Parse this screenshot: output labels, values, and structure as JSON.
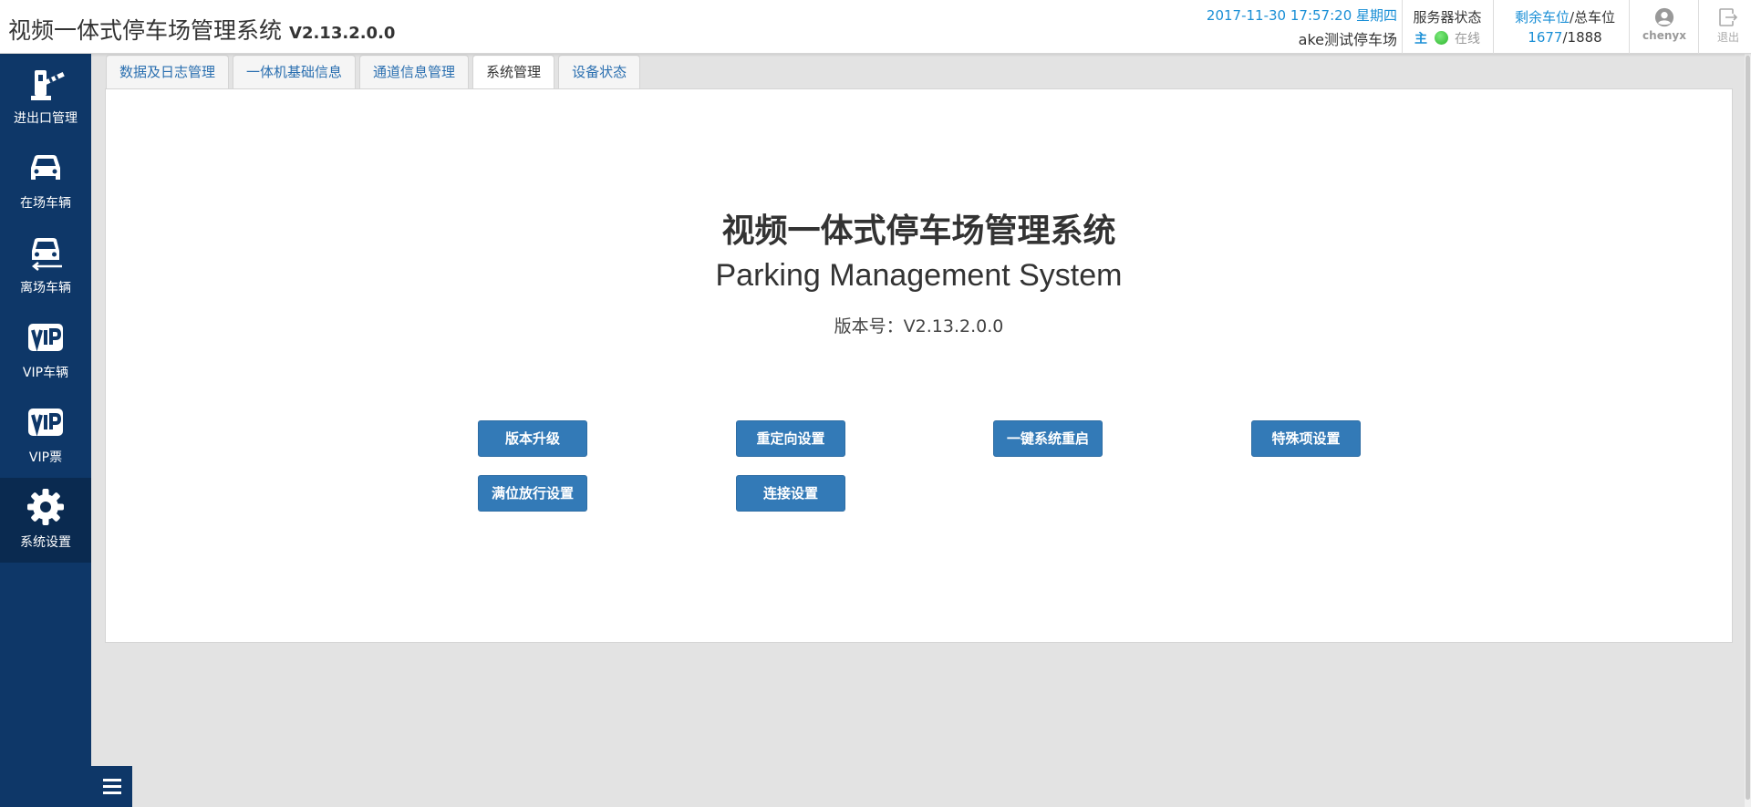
{
  "header": {
    "title": "视频一体式停车场管理系统",
    "version": "V2.13.2.0.0",
    "datetime": "2017-11-30 17:57:20 星期四",
    "lot_name": "ake测试停车场",
    "server": {
      "label": "服务器状态",
      "role": "主",
      "status": "在线",
      "status_color": "#2db52d"
    },
    "parking": {
      "remaining_label": "剩余车位",
      "total_label": "/总车位",
      "remaining": "1677",
      "total": "/1888"
    },
    "user": {
      "name": "chenyx",
      "icon": "user-circle-icon"
    },
    "logout": {
      "label": "退出",
      "icon": "logout-icon"
    }
  },
  "sidebar": {
    "items": [
      {
        "label": "进出口管理",
        "icon": "barrier-gate-icon",
        "active": false
      },
      {
        "label": "在场车辆",
        "icon": "car-icon",
        "active": false
      },
      {
        "label": "离场车辆",
        "icon": "car-leave-icon",
        "active": false
      },
      {
        "label": "VIP车辆",
        "icon": "vip-icon",
        "active": false
      },
      {
        "label": "VIP票",
        "icon": "vip-icon",
        "active": false
      },
      {
        "label": "系统设置",
        "icon": "gear-icon",
        "active": true
      }
    ],
    "menu_toggle_icon": "hamburger-icon"
  },
  "tabs": [
    {
      "label": "数据及日志管理",
      "active": false
    },
    {
      "label": "一体机基础信息",
      "active": false
    },
    {
      "label": "通道信息管理",
      "active": false
    },
    {
      "label": "系统管理",
      "active": true
    },
    {
      "label": "设备状态",
      "active": false
    }
  ],
  "main": {
    "title": "视频一体式停车场管理系统",
    "subtitle": "Parking Management System",
    "version_text": "版本号：V2.13.2.0.0",
    "buttons": {
      "upgrade": "版本升级",
      "redirect": "重定向设置",
      "restart": "一键系统重启",
      "special": "特殊项设置",
      "full_release": "满位放行设置",
      "connection": "连接设置"
    }
  },
  "colors": {
    "accent": "#1a8fd6",
    "sidebar": "#0e3768",
    "sidebar_active": "#0a2a50",
    "button": "#337ab7",
    "tab_link": "#2a6fb0"
  }
}
